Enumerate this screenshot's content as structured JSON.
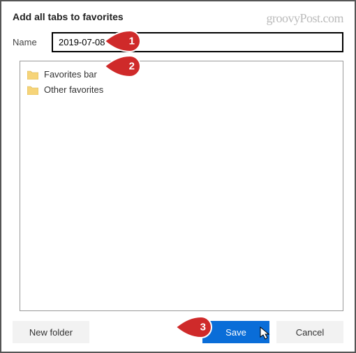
{
  "dialog": {
    "title": "Add all tabs to favorites",
    "name_label": "Name",
    "name_value": "2019-07-08"
  },
  "folders": [
    {
      "label": "Favorites bar"
    },
    {
      "label": "Other favorites"
    }
  ],
  "buttons": {
    "new_folder": "New folder",
    "save": "Save",
    "cancel": "Cancel"
  },
  "annotations": [
    {
      "num": "1"
    },
    {
      "num": "2"
    },
    {
      "num": "3"
    }
  ],
  "watermark": "groovyPost.com"
}
